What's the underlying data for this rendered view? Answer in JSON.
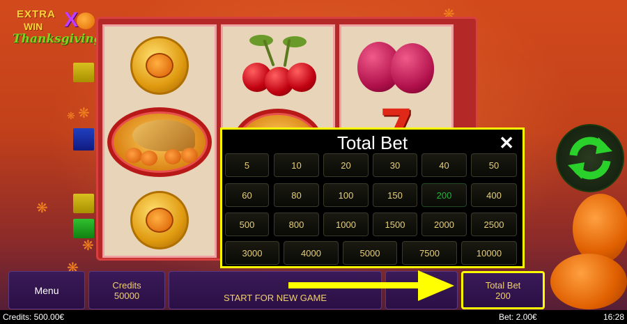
{
  "game": {
    "logo": {
      "line1": "EXTRA",
      "line2": "WIN",
      "x": "X",
      "line3": "Thanksgiving"
    }
  },
  "dialog": {
    "title": "Total Bet",
    "close_icon": "close-icon",
    "rows": [
      [
        "5",
        "10",
        "20",
        "30",
        "40",
        "50"
      ],
      [
        "60",
        "80",
        "100",
        "150",
        "200",
        "400"
      ],
      [
        "500",
        "800",
        "1000",
        "1500",
        "2000",
        "2500"
      ],
      [
        "3000",
        "4000",
        "5000",
        "7500",
        "10000"
      ]
    ],
    "selected": "200"
  },
  "bottom_bar": {
    "menu_label": "Menu",
    "credits_label": "Credits",
    "credits_value": "50000",
    "start_label": "START FOR NEW GAME",
    "total_bet_label": "Total Bet",
    "total_bet_value": "200"
  },
  "status_bar": {
    "credits": "Credits: 500.00€",
    "bet": "Bet: 2.00€",
    "time": "16:28"
  },
  "colors": {
    "highlight": "#ffff00",
    "selected_bet": "#22b33a",
    "bet_text": "#e6cf7a",
    "spin": "#2bd12b"
  }
}
